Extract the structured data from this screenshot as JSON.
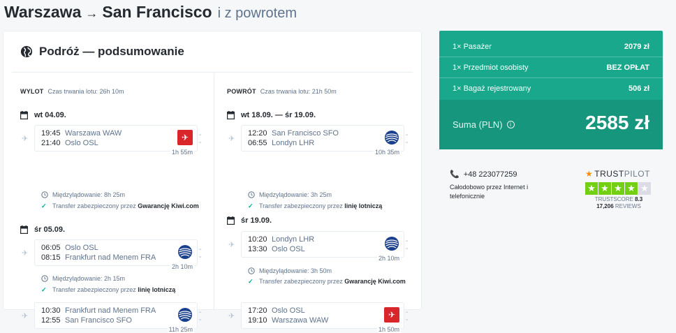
{
  "header": {
    "from": "Warszawa",
    "arrow": "→",
    "to": "San Francisco",
    "trip_type": "i z powrotem"
  },
  "summary": {
    "title": "Podróż — podsumowanie"
  },
  "outbound": {
    "label": "WYLOT",
    "duration": "Czas trwania lotu: 26h 10m",
    "days": [
      {
        "date": "wt 04.09.",
        "segments": [
          {
            "dep_time": "19:45",
            "dep_place": "Warszawa WAW",
            "arr_time": "21:40",
            "arr_place": "Oslo OSL",
            "duration": "1h 55m",
            "airline": "norwegian"
          }
        ],
        "layover": "Międzylądowanie: 8h 25m",
        "transfer_prefix": "Transfer zabezpieczony przez ",
        "transfer_bold": "Gwarancję Kiwi.com"
      },
      {
        "date": "śr 05.09.",
        "segments": [
          {
            "dep_time": "06:05",
            "dep_place": "Oslo OSL",
            "arr_time": "08:15",
            "arr_place": "Frankfurt nad Menem FRA",
            "duration": "2h 10m",
            "airline": "united"
          },
          {
            "dep_time": "10:30",
            "dep_place": "Frankfurt nad Menem FRA",
            "arr_time": "12:55",
            "arr_place": "San Francisco SFO",
            "duration": "11h 25m",
            "airline": "united"
          }
        ],
        "layover": "Międzylądowanie: 2h 15m",
        "transfer_prefix": "Transfer zabezpieczony przez ",
        "transfer_bold": "linię lotniczą"
      }
    ]
  },
  "inbound": {
    "label": "POWRÓT",
    "duration": "Czas trwania lotu: 21h 50m",
    "days": [
      {
        "date": "wt 18.09. — śr 19.09.",
        "segments": [
          {
            "dep_time": "12:20",
            "dep_place": "San Francisco SFO",
            "arr_time": "06:55",
            "arr_place": "Londyn LHR",
            "duration": "10h 35m",
            "airline": "united"
          }
        ],
        "layover": "Międzylądowanie: 3h 25m",
        "transfer_prefix": "Transfer zabezpieczony przez ",
        "transfer_bold": "linię lotniczą"
      },
      {
        "date": "śr 19.09.",
        "segments": [
          {
            "dep_time": "10:20",
            "dep_place": "Londyn LHR",
            "arr_time": "13:30",
            "arr_place": "Oslo OSL",
            "duration": "2h 10m",
            "airline": "united"
          },
          {
            "dep_time": "17:20",
            "dep_place": "Oslo OSL",
            "arr_time": "19:10",
            "arr_place": "Warszawa WAW",
            "duration": "1h 50m",
            "airline": "norwegian"
          }
        ],
        "layover": "Międzylądowanie: 3h 50m",
        "transfer_prefix": "Transfer zabezpieczony przez ",
        "transfer_bold": "Gwarancję Kiwi.com"
      }
    ]
  },
  "price": {
    "rows": [
      {
        "label": "1× Pasażer",
        "value": "2079 zł"
      },
      {
        "label": "1× Przedmiot osobisty",
        "value": "BEZ OPŁAT"
      },
      {
        "label": "1× Bagaż rejestrowany",
        "value": "506 zł"
      }
    ],
    "sum_label": "Suma (PLN)",
    "sum_value": "2585 zł",
    "colors": {
      "accent": "#1aa88c",
      "accent_dark": "#16967c"
    }
  },
  "contact": {
    "phone": "+48 223077259",
    "description": "Całodobowo przez Internet i telefonicznie"
  },
  "trustpilot": {
    "brand_a": "TRUST",
    "brand_b": "PILOT",
    "score_label": "TRUSTSCORE",
    "score": "8.3",
    "reviews_count": "17,206",
    "reviews_label": "REVIEWS",
    "stars_filled": 4,
    "stars_total": 5
  }
}
